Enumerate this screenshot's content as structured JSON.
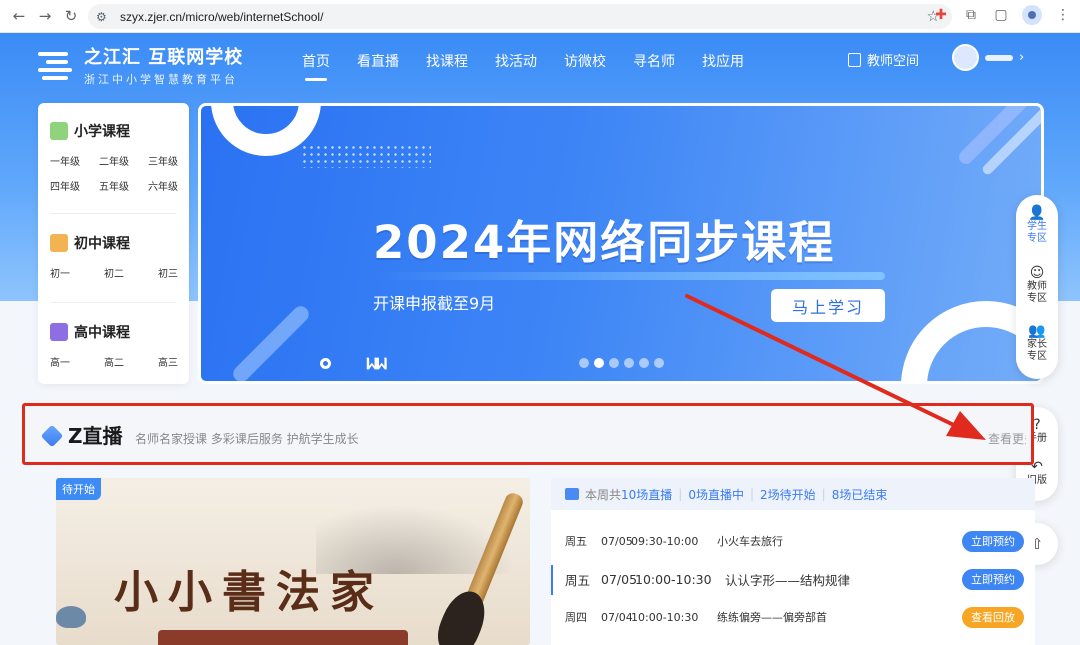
{
  "browser": {
    "url": "szyx.zjer.cn/micro/web/internetSchool/",
    "icons": [
      "back-icon",
      "forward-icon",
      "reload-icon",
      "site-settings-icon",
      "bookmark-star-icon",
      "extension-icon",
      "puzzle-icon",
      "profile-icon",
      "menu-icon"
    ]
  },
  "header": {
    "logo_title": "之江汇 互联网学校",
    "logo_subtitle": "浙江中小学智慧教育平台",
    "nav": [
      {
        "label": "首页",
        "active": true
      },
      {
        "label": "看直播",
        "active": false
      },
      {
        "label": "找课程",
        "active": false
      },
      {
        "label": "找活动",
        "active": false
      },
      {
        "label": "访微校",
        "active": false
      },
      {
        "label": "寻名师",
        "active": false
      },
      {
        "label": "找应用",
        "active": false
      }
    ],
    "teacher_space": "教师空间"
  },
  "categories": [
    {
      "title": "小学课程",
      "color": "#8fd37d",
      "grades": [
        "一年级",
        "二年级",
        "三年级",
        "四年级",
        "五年级",
        "六年级"
      ]
    },
    {
      "title": "初中课程",
      "color": "#f2b453",
      "grades": [
        "初一",
        "初二",
        "初三"
      ]
    },
    {
      "title": "高中课程",
      "color": "#8e6fe3",
      "grades": [
        "高一",
        "高二",
        "高三"
      ]
    }
  ],
  "banner": {
    "title": "2024年网络同步课程",
    "subtitle": "开课申报截至9月",
    "cta": "马上学习",
    "slide_count": 6,
    "active_slide": 2
  },
  "floatbar": {
    "items": [
      {
        "label": "学生专区",
        "icon": "student-icon",
        "active": true
      },
      {
        "label": "教师专区",
        "icon": "teacher-icon",
        "active": false
      },
      {
        "label": "家长专区",
        "icon": "parent-icon",
        "active": false
      }
    ],
    "help": [
      {
        "label": "手册",
        "icon": "manual-icon"
      },
      {
        "label": "旧版",
        "icon": "old-version-icon"
      }
    ],
    "top_icon": "rocket-icon"
  },
  "zlive": {
    "title": "Z直播",
    "slogan": "名师名家授课 多彩课后服务 护航学生成长",
    "more": "查看更多"
  },
  "course": {
    "tag": "待开始",
    "title": "小小書法家"
  },
  "schedule": {
    "summary": {
      "prefix": "本周共",
      "total": "10场直播",
      "live": "0场直播中",
      "pending": "2场待开始",
      "ended": "8场已结束"
    },
    "rows": [
      {
        "day": "周五",
        "date": "07/05",
        "time": "09:30-10:00",
        "name": "小火车去旅行",
        "action": "立即预约",
        "style": "blue",
        "current": false
      },
      {
        "day": "周五",
        "date": "07/05",
        "time": "10:00-10:30",
        "name": "认认字形——结构规律",
        "action": "立即预约",
        "style": "blue",
        "current": true
      },
      {
        "day": "周四",
        "date": "07/04",
        "time": "10:00-10:30",
        "name": "练练偏旁——偏旁部首",
        "action": "查看回放",
        "style": "orange",
        "current": false
      }
    ]
  },
  "annotation": {
    "highlight_color": "#e02a1d"
  }
}
